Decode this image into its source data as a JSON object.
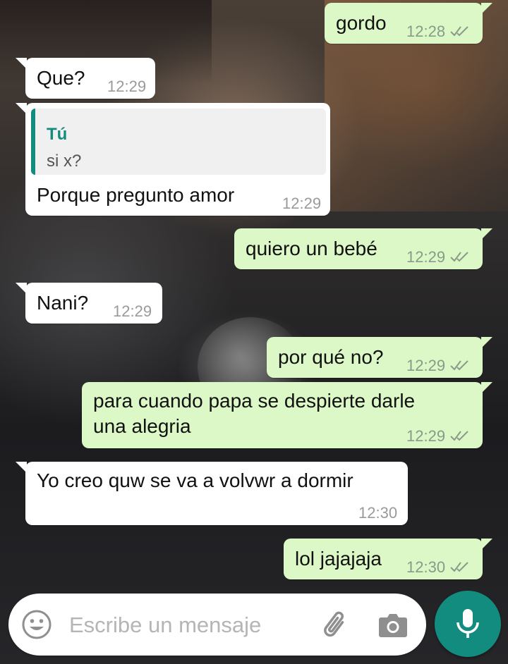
{
  "colors": {
    "outgoing_bubble": "#dcf8c6",
    "incoming_bubble": "#ffffff",
    "accent": "#128c7e",
    "read_ticks": "#8a9a8a"
  },
  "messages": [
    {
      "direction": "out",
      "text": "gordo",
      "time": "12:28",
      "status": "delivered"
    },
    {
      "direction": "in",
      "text": "Que?",
      "time": "12:29"
    },
    {
      "direction": "in",
      "quote_author": "Tú",
      "quote_text": "si x?",
      "text": "Porque pregunto amor",
      "time": "12:29"
    },
    {
      "direction": "out",
      "text": "quiero un bebé",
      "time": "12:29",
      "status": "delivered"
    },
    {
      "direction": "in",
      "text": "Nani?",
      "time": "12:29"
    },
    {
      "direction": "out",
      "text": "por qué no?",
      "time": "12:29",
      "status": "delivered"
    },
    {
      "direction": "out",
      "text_line1": "para cuando papa se despierte darle",
      "text_line2": "una alegria",
      "time": "12:29",
      "status": "delivered"
    },
    {
      "direction": "in",
      "text": "Yo creo quw se va a volvwr a dormir",
      "time": "12:30"
    },
    {
      "direction": "out",
      "text": "lol jajajaja",
      "time": "12:30",
      "status": "delivered"
    }
  ],
  "input": {
    "placeholder": "Escribe un mensaje",
    "value": ""
  },
  "icons": {
    "emoji": "emoji-icon",
    "attach": "paperclip-icon",
    "camera": "camera-icon",
    "mic": "microphone-icon",
    "ticks": "double-check-icon"
  }
}
